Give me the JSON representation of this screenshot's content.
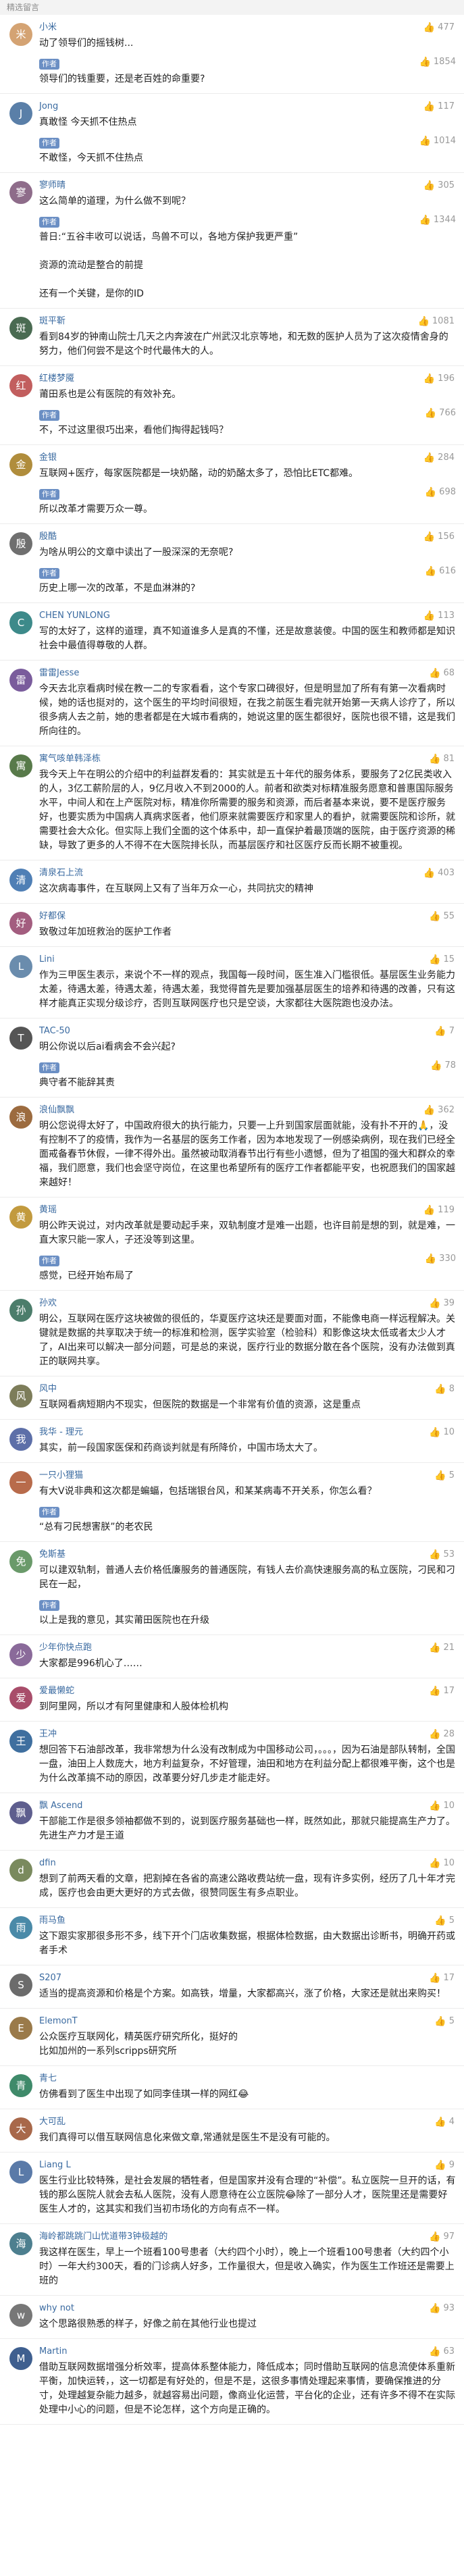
{
  "section_title": "精选留言",
  "author_label": "作者",
  "comments": [
    {
      "nickname": "小米",
      "avatar_char": "米",
      "avatar_color": "#d4a373",
      "likes": "477",
      "text": "动了领导们的摇钱树...",
      "replies": [
        {
          "likes": "1854",
          "text": "领导们的钱重要，还是老百姓的命重要?"
        }
      ]
    },
    {
      "nickname": "Jong",
      "avatar_char": "J",
      "avatar_color": "#5a7fa8",
      "likes": "117",
      "text": "真敢怪 今天抓不住热点",
      "replies": [
        {
          "likes": "1014",
          "text": "不敢怪，今天抓不住热点"
        }
      ]
    },
    {
      "nickname": "寥师晴",
      "avatar_char": "寥",
      "avatar_color": "#8e6c8a",
      "likes": "305",
      "text": "这么简单的道理，为什么做不到呢？",
      "replies": [
        {
          "likes": "1344",
          "text": "普日:“五谷丰收可以说话，鸟兽不可以，各地方保护我更严重”\n\n资源的流动是整合的前提\n\n还有一个关键，是你的ID"
        }
      ]
    },
    {
      "nickname": "斑平靳",
      "avatar_char": "斑",
      "avatar_color": "#4a6b52",
      "likes": "1081",
      "text": "看到84岁的钟南山院士几天之内奔波在广州武汉北京等地，和无数的医护人员为了这次疫情舍身的努力，他们何尝不是这个时代最伟大的人。",
      "replies": []
    },
    {
      "nickname": "红楼梦魇",
      "avatar_char": "红",
      "avatar_color": "#c25e5e",
      "likes": "196",
      "text": "莆田系也是公有医院的有效补充。",
      "replies": [
        {
          "likes": "766",
          "text": "不，不过这里很巧出来，看他们掏得起钱吗？"
        }
      ]
    },
    {
      "nickname": "金银",
      "avatar_char": "金",
      "avatar_color": "#b08d3c",
      "likes": "284",
      "text": "互联网+医疗，每家医院都是一块奶酪，动的奶酪太多了，恐怕比ETC都难。",
      "replies": [
        {
          "likes": "698",
          "text": "所以改革才需要万众一尊。"
        }
      ]
    },
    {
      "nickname": "殷酷",
      "avatar_char": "殷",
      "avatar_color": "#6f6f6f",
      "likes": "156",
      "text": "为啥从明公的文章中读出了一股深深的无奈呢?",
      "replies": [
        {
          "likes": "616",
          "text": "历史上哪一次的改革，不是血淋淋的?"
        }
      ]
    },
    {
      "nickname": "CHEN YUNLONG",
      "avatar_char": "C",
      "avatar_color": "#3d8a8a",
      "likes": "113",
      "text": "写的太好了，这样的道理，真不知道谁多人是真的不懂，还是故意装傻。中国的医生和教师都是知识社会中最值得尊敬的人群。",
      "replies": []
    },
    {
      "nickname": "雷雷Jesse",
      "avatar_char": "雷",
      "avatar_color": "#7a5c9c",
      "likes": "68",
      "text": "今天去北京看病时候在教一二的专家看看，这个专家口碑很好，但是明显加了所有有第一次看病时候，她的话也挺对的，这个医生的平均时间很短，在我之前医生看完就开始第一天病人诊疗了，所以很多病人去之前，她的患者都是在大城市看病的，她说这里的医生都很好，医院也很不错，这是我们所向往的。",
      "replies": []
    },
    {
      "nickname": "寓气咳单韩泽栋",
      "avatar_char": "寓",
      "avatar_color": "#587a4a",
      "likes": "81",
      "text": "我今天上午在明公的介绍中的利益群发看的：其实就是五十年代的服务体系，要服务了2亿民类收入的人，3亿工薪阶层的人，9亿月收入不到2000的人。前者和欲类对标精准服务愿意和普惠国际服务水平，中间人和在上产医院对标，精准你所需要的服务和资源，而后者基本来说，要不是医疗服务好，也要实质为中国病人真病求医者，他们原来就需要医疗和家里人的看护，就需要医院和诊所，就需要社会大众化。但实际上我们全面的这个体系中，却一直保护着最顶端的医院，由于医疗资源的稀缺，导致了更多的人不得不在大医院排长队，而基层医疗和社区医疗反而长期不被重视。",
      "replies": []
    },
    {
      "nickname": "清泉石上流",
      "avatar_char": "清",
      "avatar_color": "#4f7fb5",
      "likes": "403",
      "text": "这次病毒事件，在互联网上又有了当年万众一心，共同抗灾的精神",
      "replies": []
    },
    {
      "nickname": "好都保",
      "avatar_char": "好",
      "avatar_color": "#a35d7f",
      "likes": "55",
      "text": "致敬过年加班救治的医护工作者",
      "replies": []
    },
    {
      "nickname": "Lini",
      "avatar_char": "L",
      "avatar_color": "#6a8cad",
      "likes": "15",
      "text": "作为三甲医生表示，来说个不一样的观点，我国每一段时间，医生准入门槛很低。基层医生业务能力太差，待遇太差，待遇太差，待遇太差，我觉得首先是要加强基层医生的培养和待遇的改善，只有这样才能真正实现分级诊疗，否则互联网医疗也只是空谈，大家都往大医院跑也没办法。",
      "replies": []
    },
    {
      "nickname": "TAC-50",
      "avatar_char": "T",
      "avatar_color": "#555555",
      "likes": "7",
      "text": "明公你说以后ai看病会不会兴起?",
      "replies": [
        {
          "likes": "78",
          "text": "典守者不能辞其责"
        }
      ]
    },
    {
      "nickname": "浪仙飘飘",
      "avatar_char": "浪",
      "avatar_color": "#9c6b3f",
      "likes": "362",
      "text": "明公您说得太好了，中国政府很大的执行能力，只要一上升到国家层面就能，没有扑不开的🙏，没有控制不了的疫情，我作为一名基层的医务工作者，因为本地发现了一例感染病例，现在我们已经全面戒备春节休假，一律不得外出。虽然被动取消春节出行有些小遗憾，但为了祖国的强大和群众的幸福，我们愿意，我们也会坚守岗位，在这里也希望所有的医疗工作者都能平安，也祝愿我们的国家越来越好！",
      "replies": []
    },
    {
      "nickname": "黄瑶",
      "avatar_char": "黄",
      "avatar_color": "#c29a3e",
      "likes": "119",
      "text": "明公昨天说过，对内改革就是要动起手来，双轨制度才是难一出题，也许目前是想的到，就是难，一直大家只能一家人，子还没等到这里。",
      "replies": [
        {
          "likes": "330",
          "text": "感觉，已经开始布局了"
        }
      ]
    },
    {
      "nickname": "孙欢",
      "avatar_char": "孙",
      "avatar_color": "#4c7d6b",
      "likes": "39",
      "text": "明公，互联网在医疗这块被做的很低的，华夏医疗这块还是要面对面，不能像电商一样远程解决。关键就是数据的共享取决于统一的标准和检测，医学实验室（检验科）和影像这块太低或者太少人才了，AI出来可以解决一部分问题，可是总的来说，医疗行业的数据分散在各个医院，没有办法做到真正的联网共享。",
      "replies": []
    },
    {
      "nickname": "风中",
      "avatar_char": "风",
      "avatar_color": "#7d7d5a",
      "likes": "8",
      "text": "互联网看病短期内不现实，但医院的数据是一个非常有价值的资源，这是重点",
      "replies": []
    },
    {
      "nickname": "我华 - 理元",
      "avatar_char": "我",
      "avatar_color": "#5d6fa8",
      "likes": "10",
      "text": "其实，前一段国家医保和药商谈判就是有所降价，中国市场太大了。",
      "replies": []
    },
    {
      "nickname": "一只小狸猫",
      "avatar_char": "一",
      "avatar_color": "#b86b4b",
      "likes": "5",
      "text": "有大V说非典和这次都是蝙蝠，包括瑞银台风，和某某病毒不开关系，你怎么看？",
      "replies": [
        {
          "likes": "",
          "text": "“总有刁民想害朕”的老农民"
        }
      ]
    },
    {
      "nickname": "免斯基",
      "avatar_char": "免",
      "avatar_color": "#6a9a6a",
      "likes": "53",
      "text": "可以建双轨制，普通人去价格低廉服务的普通医院，有钱人去价高快速服务高的私立医院，刁民和刁民在一起，",
      "replies": [
        {
          "likes": "",
          "text": "以上是我的意见，其实莆田医院也在升级"
        }
      ]
    },
    {
      "nickname": "少年你快点跑",
      "avatar_char": "少",
      "avatar_color": "#8a6a9a",
      "likes": "21",
      "text": "大家都是996机心了……",
      "replies": []
    },
    {
      "nickname": "爱最懒蛇",
      "avatar_char": "爱",
      "avatar_color": "#a84d6a",
      "likes": "17",
      "text": "到阿里网，所以才有阿里健康和人股体检机构",
      "replies": []
    },
    {
      "nickname": "王冲",
      "avatar_char": "王",
      "avatar_color": "#3f6f9f",
      "likes": "28",
      "text": "想回答下石油部改革，我非常想为什么没有改制成为中国移动公司，。。。，因为石油是部队转制，全国一盘，油田上人数庞大，地方利益复杂，不好管理，油田和地方在利益分配上都很难平衡，这个也是为什么改革搞不动的原因，改革要分好几步走才能走好。",
      "replies": []
    },
    {
      "nickname": "飘 Ascend",
      "avatar_char": "飘",
      "avatar_color": "#5e5e8e",
      "likes": "10",
      "text": "干部能工作是很多领袖都做不到的，说到医疗服务基础也一样，既然如此，那就只能提高生产力了。先进生产力才是王道",
      "replies": []
    },
    {
      "nickname": "dfin",
      "avatar_char": "d",
      "avatar_color": "#7a8a5e",
      "likes": "10",
      "text": "想到了前两天看的文章，把割掉在各省的高速公路收费站统一盘，现有许多实例，经历了几十年才完成，医疗也会由更大更好的方式去做，很赞同医生有多点职业。",
      "replies": []
    },
    {
      "nickname": "雨马鱼",
      "avatar_char": "雨",
      "avatar_color": "#4a8aa8",
      "likes": "5",
      "text": "这下跟实家那很多形不多，线下开个门店收集数据，根据体检数据，由大数据出诊断书，明确开药或者手术",
      "replies": []
    },
    {
      "nickname": "S207",
      "avatar_char": "S",
      "avatar_color": "#6b6b6b",
      "likes": "17",
      "text": "适当的提高资源和价格是个方案。如高铁，增量，大家都高兴，涨了价格，大家还是就出来购买！",
      "replies": []
    },
    {
      "nickname": "ElemonT",
      "avatar_char": "E",
      "avatar_color": "#9a7a4a",
      "likes": "5",
      "text": "公众医疗互联网化，精英医疗研究所化，挺好的\n比如加州的一系列scripps研究所",
      "replies": []
    },
    {
      "nickname": "青七",
      "avatar_char": "青",
      "avatar_color": "#3f8a6a",
      "likes": "",
      "text": "仿佛看到了医生中出现了如同李佳琪一样的网红😂",
      "replies": []
    },
    {
      "nickname": "大可乱",
      "avatar_char": "大",
      "avatar_color": "#a8684a",
      "likes": "4",
      "text": "我们真得可以借互联网信息化来做文章,常通就是医生不是没有可能的。",
      "replies": []
    },
    {
      "nickname": "Liang L",
      "avatar_char": "L",
      "avatar_color": "#5a7aa8",
      "likes": "9",
      "text": "医生行业比较特殊，是社会发展的牺牲者，但是国家并没有合理的“补偿”。私立医院一旦开的话，有钱的那么医院人就会去私人医院，没有人愿意待在公立医院😂除了一部分人才，医院里还是需要好医生人才的，这其实和我们当初市场化的方向有点不一样。",
      "replies": []
    },
    {
      "nickname": "海岭都跳跳门山忧道带3钟极越的",
      "avatar_char": "海",
      "avatar_color": "#4d7f8f",
      "likes": "97",
      "text": "我这样在医生，早上一个班看100号患者（大约四个小时），晚上一个班看100号患者（大约四个小时）一年大约300天，看的门诊病人好多，工作量很大，但是收入确实，作为医生工作班还是需要上班的",
      "replies": []
    },
    {
      "nickname": "why not",
      "avatar_char": "w",
      "avatar_color": "#777777",
      "likes": "93",
      "text": "这个思路很熟悉的样子，好像之前在其他行业也提过",
      "replies": []
    },
    {
      "nickname": "Martin",
      "avatar_char": "M",
      "avatar_color": "#3f5f8f",
      "likes": "63",
      "text": "借助互联网数据增强分析效率，提高体系整体能力，降低成本；同时借助互联网的信息流使体系重新平衡，加快运转，，这一切都是有好处的，但是不是，这很多事情处理起来事情，要确保推进的分寸，处理越复杂能力越多，就越容易出问题，像商业化运营，平台化的企业，还有许多不得不在实际处理中小心的问题，但是不论怎样，这个方向是正确的。",
      "replies": []
    }
  ]
}
